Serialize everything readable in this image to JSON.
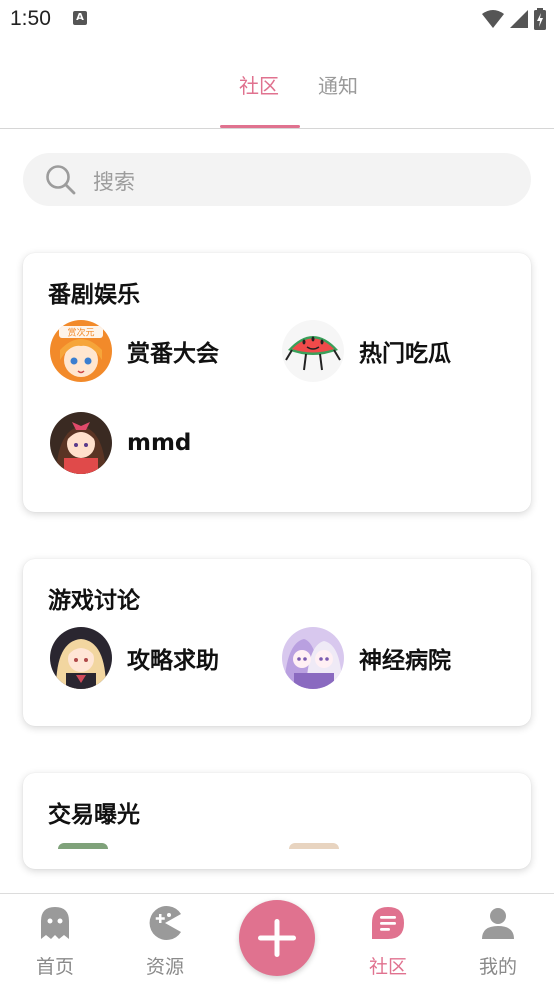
{
  "status_bar": {
    "time": "1:50",
    "notification_icon": "A"
  },
  "tabs": [
    {
      "label": "社区",
      "active": true
    },
    {
      "label": "通知",
      "active": false
    }
  ],
  "search": {
    "placeholder": "搜索"
  },
  "sections": [
    {
      "title": "番剧娱乐",
      "items": [
        {
          "label": "赏番大会",
          "avatar_badge": "赏次元"
        },
        {
          "label": "热门吃瓜"
        },
        {
          "label": "mmd"
        }
      ]
    },
    {
      "title": "游戏讨论",
      "items": [
        {
          "label": "攻略求助"
        },
        {
          "label": "神经病院"
        }
      ]
    },
    {
      "title": "交易曝光",
      "items": []
    }
  ],
  "bottom_nav": [
    {
      "label": "首页",
      "icon": "ghost-icon",
      "active": false
    },
    {
      "label": "资源",
      "icon": "pacman-icon",
      "active": false
    },
    {
      "label": "社区",
      "icon": "chat-icon",
      "active": true
    },
    {
      "label": "我的",
      "icon": "person-icon",
      "active": false
    }
  ],
  "colors": {
    "accent": "#e0728f",
    "inactive": "#8a8a8a",
    "search_bg": "#f3f3f3"
  }
}
